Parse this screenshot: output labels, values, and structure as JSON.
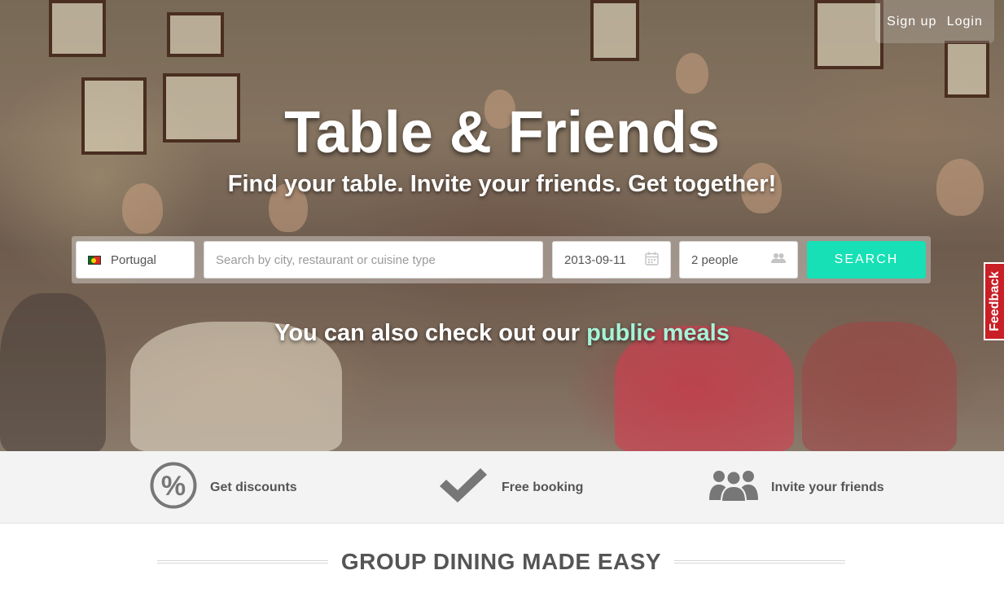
{
  "header": {
    "signup_label": "Sign up",
    "login_label": "Login"
  },
  "hero": {
    "title": "Table & Friends",
    "subtitle": "Find your table. Invite your friends. Get together!",
    "public_prefix": "You can also check out our ",
    "public_link": "public meals"
  },
  "search": {
    "country": "Portugal",
    "query_placeholder": "Search by city, restaurant or cuisine type",
    "date": "2013-09-11",
    "people": "2 people",
    "button_label": "SEARCH"
  },
  "feedback": {
    "label": "Feedback"
  },
  "features": [
    {
      "label": "Get discounts",
      "icon": "percent-icon"
    },
    {
      "label": "Free booking",
      "icon": "checkmark-icon"
    },
    {
      "label": "Invite your friends",
      "icon": "group-icon"
    }
  ],
  "section": {
    "title": "GROUP DINING MADE EASY"
  },
  "colors": {
    "accent": "#17e0b6",
    "link_highlight": "#a6f4d8",
    "feedback": "#c91f26",
    "feature_text": "#555555"
  }
}
